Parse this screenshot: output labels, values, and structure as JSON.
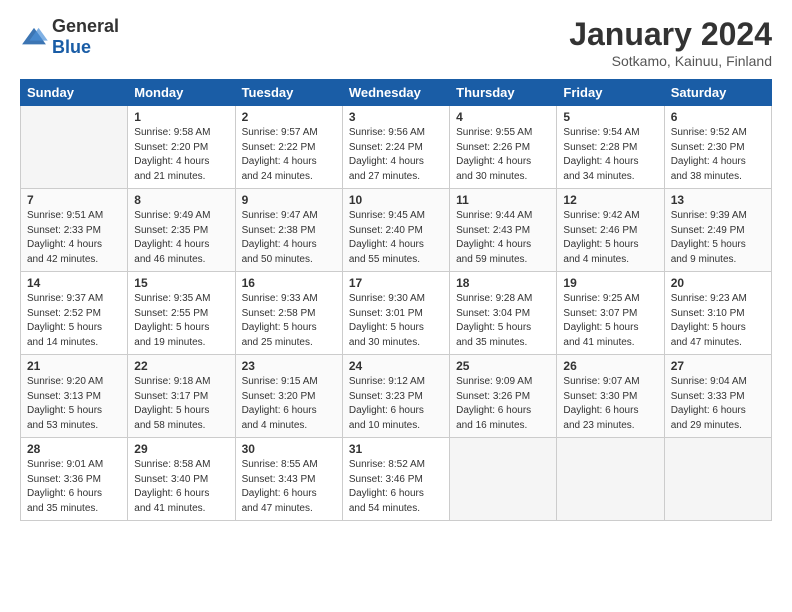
{
  "logo": {
    "general": "General",
    "blue": "Blue"
  },
  "header": {
    "title": "January 2024",
    "subtitle": "Sotkamo, Kainuu, Finland"
  },
  "days_of_week": [
    "Sunday",
    "Monday",
    "Tuesday",
    "Wednesday",
    "Thursday",
    "Friday",
    "Saturday"
  ],
  "weeks": [
    [
      {
        "day": "",
        "info": ""
      },
      {
        "day": "1",
        "info": "Sunrise: 9:58 AM\nSunset: 2:20 PM\nDaylight: 4 hours\nand 21 minutes."
      },
      {
        "day": "2",
        "info": "Sunrise: 9:57 AM\nSunset: 2:22 PM\nDaylight: 4 hours\nand 24 minutes."
      },
      {
        "day": "3",
        "info": "Sunrise: 9:56 AM\nSunset: 2:24 PM\nDaylight: 4 hours\nand 27 minutes."
      },
      {
        "day": "4",
        "info": "Sunrise: 9:55 AM\nSunset: 2:26 PM\nDaylight: 4 hours\nand 30 minutes."
      },
      {
        "day": "5",
        "info": "Sunrise: 9:54 AM\nSunset: 2:28 PM\nDaylight: 4 hours\nand 34 minutes."
      },
      {
        "day": "6",
        "info": "Sunrise: 9:52 AM\nSunset: 2:30 PM\nDaylight: 4 hours\nand 38 minutes."
      }
    ],
    [
      {
        "day": "7",
        "info": "Sunrise: 9:51 AM\nSunset: 2:33 PM\nDaylight: 4 hours\nand 42 minutes."
      },
      {
        "day": "8",
        "info": "Sunrise: 9:49 AM\nSunset: 2:35 PM\nDaylight: 4 hours\nand 46 minutes."
      },
      {
        "day": "9",
        "info": "Sunrise: 9:47 AM\nSunset: 2:38 PM\nDaylight: 4 hours\nand 50 minutes."
      },
      {
        "day": "10",
        "info": "Sunrise: 9:45 AM\nSunset: 2:40 PM\nDaylight: 4 hours\nand 55 minutes."
      },
      {
        "day": "11",
        "info": "Sunrise: 9:44 AM\nSunset: 2:43 PM\nDaylight: 4 hours\nand 59 minutes."
      },
      {
        "day": "12",
        "info": "Sunrise: 9:42 AM\nSunset: 2:46 PM\nDaylight: 5 hours\nand 4 minutes."
      },
      {
        "day": "13",
        "info": "Sunrise: 9:39 AM\nSunset: 2:49 PM\nDaylight: 5 hours\nand 9 minutes."
      }
    ],
    [
      {
        "day": "14",
        "info": "Sunrise: 9:37 AM\nSunset: 2:52 PM\nDaylight: 5 hours\nand 14 minutes."
      },
      {
        "day": "15",
        "info": "Sunrise: 9:35 AM\nSunset: 2:55 PM\nDaylight: 5 hours\nand 19 minutes."
      },
      {
        "day": "16",
        "info": "Sunrise: 9:33 AM\nSunset: 2:58 PM\nDaylight: 5 hours\nand 25 minutes."
      },
      {
        "day": "17",
        "info": "Sunrise: 9:30 AM\nSunset: 3:01 PM\nDaylight: 5 hours\nand 30 minutes."
      },
      {
        "day": "18",
        "info": "Sunrise: 9:28 AM\nSunset: 3:04 PM\nDaylight: 5 hours\nand 35 minutes."
      },
      {
        "day": "19",
        "info": "Sunrise: 9:25 AM\nSunset: 3:07 PM\nDaylight: 5 hours\nand 41 minutes."
      },
      {
        "day": "20",
        "info": "Sunrise: 9:23 AM\nSunset: 3:10 PM\nDaylight: 5 hours\nand 47 minutes."
      }
    ],
    [
      {
        "day": "21",
        "info": "Sunrise: 9:20 AM\nSunset: 3:13 PM\nDaylight: 5 hours\nand 53 minutes."
      },
      {
        "day": "22",
        "info": "Sunrise: 9:18 AM\nSunset: 3:17 PM\nDaylight: 5 hours\nand 58 minutes."
      },
      {
        "day": "23",
        "info": "Sunrise: 9:15 AM\nSunset: 3:20 PM\nDaylight: 6 hours\nand 4 minutes."
      },
      {
        "day": "24",
        "info": "Sunrise: 9:12 AM\nSunset: 3:23 PM\nDaylight: 6 hours\nand 10 minutes."
      },
      {
        "day": "25",
        "info": "Sunrise: 9:09 AM\nSunset: 3:26 PM\nDaylight: 6 hours\nand 16 minutes."
      },
      {
        "day": "26",
        "info": "Sunrise: 9:07 AM\nSunset: 3:30 PM\nDaylight: 6 hours\nand 23 minutes."
      },
      {
        "day": "27",
        "info": "Sunrise: 9:04 AM\nSunset: 3:33 PM\nDaylight: 6 hours\nand 29 minutes."
      }
    ],
    [
      {
        "day": "28",
        "info": "Sunrise: 9:01 AM\nSunset: 3:36 PM\nDaylight: 6 hours\nand 35 minutes."
      },
      {
        "day": "29",
        "info": "Sunrise: 8:58 AM\nSunset: 3:40 PM\nDaylight: 6 hours\nand 41 minutes."
      },
      {
        "day": "30",
        "info": "Sunrise: 8:55 AM\nSunset: 3:43 PM\nDaylight: 6 hours\nand 47 minutes."
      },
      {
        "day": "31",
        "info": "Sunrise: 8:52 AM\nSunset: 3:46 PM\nDaylight: 6 hours\nand 54 minutes."
      },
      {
        "day": "",
        "info": ""
      },
      {
        "day": "",
        "info": ""
      },
      {
        "day": "",
        "info": ""
      }
    ]
  ]
}
